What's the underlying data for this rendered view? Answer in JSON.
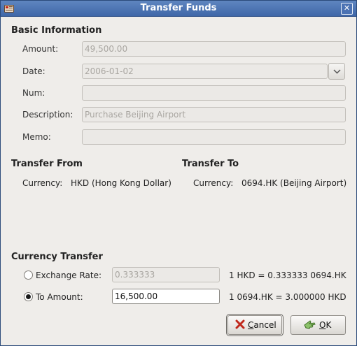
{
  "window": {
    "title": "Transfer Funds"
  },
  "basic": {
    "heading": "Basic Information",
    "amount_label": "Amount:",
    "amount_value": "49,500.00",
    "date_label": "Date:",
    "date_value": "2006-01-02",
    "num_label": "Num:",
    "num_value": "",
    "description_label": "Description:",
    "description_value": "Purchase Beijing Airport",
    "memo_label": "Memo:",
    "memo_value": ""
  },
  "transfer_from": {
    "heading": "Transfer From",
    "currency_label": "Currency:",
    "currency_value": "HKD (Hong Kong Dollar)"
  },
  "transfer_to": {
    "heading": "Transfer To",
    "currency_label": "Currency:",
    "currency_value": "0694.HK (Beijing Airport)"
  },
  "currency_transfer": {
    "heading": "Currency Transfer",
    "exchange_rate_label": "Exchange Rate:",
    "exchange_rate_value": "0.333333",
    "exchange_rate_selected": false,
    "rate_forward": "1 HKD = 0.333333 0694.HK",
    "to_amount_label": "To Amount:",
    "to_amount_value": "16,500.00",
    "to_amount_selected": true,
    "rate_reverse": "1 0694.HK = 3.000000 HKD"
  },
  "buttons": {
    "cancel_label_pre": "",
    "cancel_label_accel": "C",
    "cancel_label_post": "ancel",
    "ok_label_accel": "O",
    "ok_label_post": "K"
  },
  "icons": {
    "app": "app-icon",
    "close": "close-icon",
    "dropdown": "chevron-down-icon",
    "cancel": "cancel-x-icon",
    "ok": "ok-hand-icon"
  },
  "colors": {
    "titlebar": "#4a72b3",
    "dialog_bg": "#efedea",
    "cancel_icon": "#c0281c",
    "ok_icon": "#4a8a2c"
  }
}
